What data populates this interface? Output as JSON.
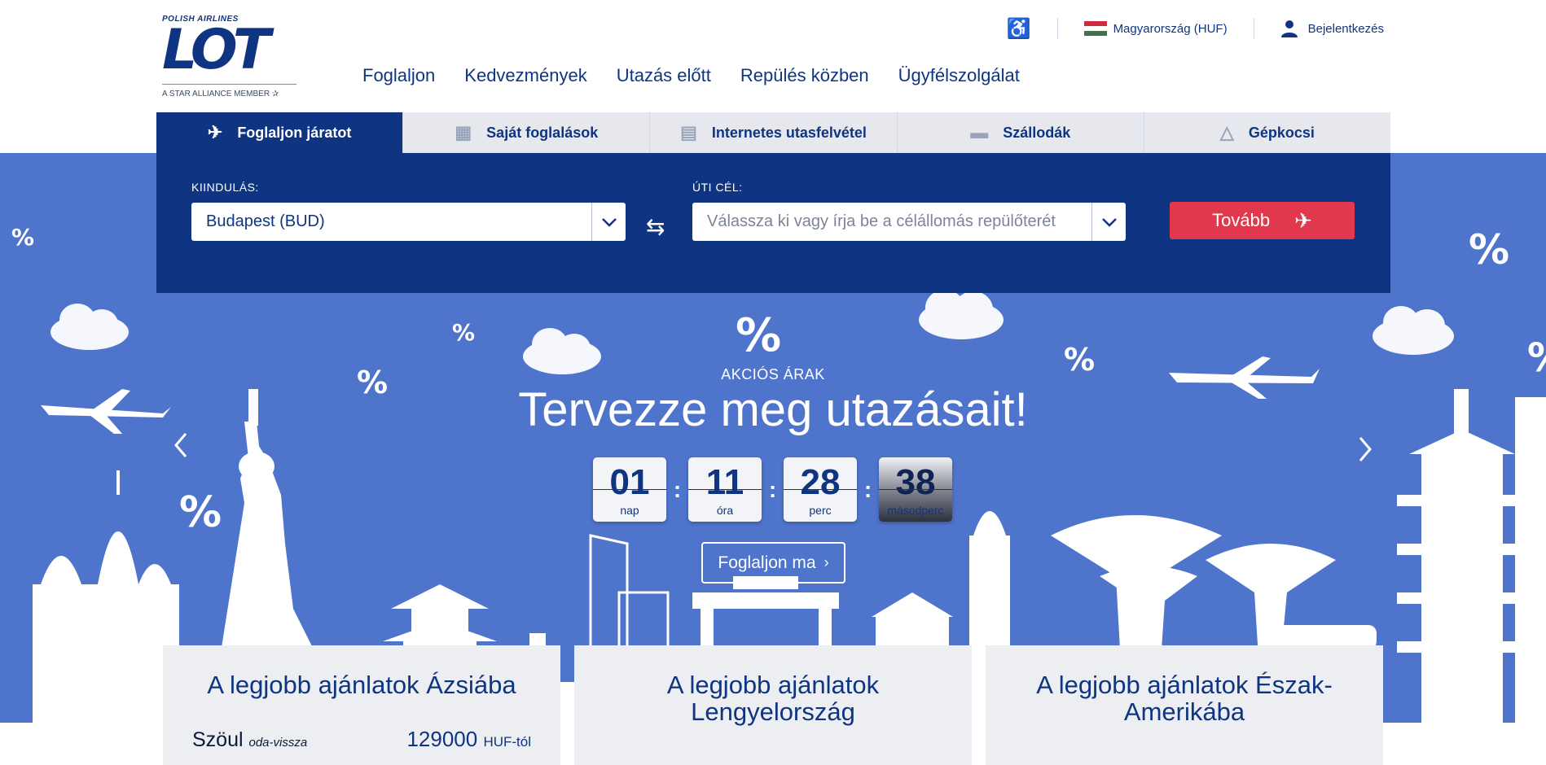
{
  "logo": {
    "supertitle": "POLISH AIRLINES",
    "mark": "LOT",
    "alliance": "A STAR ALLIANCE MEMBER"
  },
  "topbar": {
    "country": "Magyarország (HUF)",
    "login": "Bejelentkezés"
  },
  "nav": {
    "items": [
      "Foglaljon",
      "Kedvezmények",
      "Utazás előtt",
      "Repülés közben",
      "Ügyfélszolgálat"
    ]
  },
  "tabs": [
    {
      "label": "Foglaljon járatot",
      "icon": "plane-icon"
    },
    {
      "label": "Saját foglalások",
      "icon": "ticket-icon"
    },
    {
      "label": "Internetes utasfelvétel",
      "icon": "boarding-pass-icon"
    },
    {
      "label": "Szállodák",
      "icon": "bed-icon"
    },
    {
      "label": "Gépkocsi",
      "icon": "car-icon"
    }
  ],
  "search": {
    "origin_label": "KIINDULÁS:",
    "origin_value": "Budapest (BUD)",
    "destination_label": "ÚTI CÉL:",
    "destination_placeholder": "Válassza ki vagy írja be a célállomás repülőterét",
    "next_button": "Tovább"
  },
  "promo": {
    "label": "AKCIÓS ÁRAK",
    "title": "Tervezze meg utazásait!",
    "countdown": [
      {
        "value": "01",
        "unit": "nap"
      },
      {
        "value": "11",
        "unit": "óra"
      },
      {
        "value": "28",
        "unit": "perc"
      },
      {
        "value": "38",
        "unit": "másodperc"
      }
    ],
    "book_button": "Foglaljon ma",
    "percent_symbol": "%"
  },
  "cards": [
    {
      "title": "A legjobb ajánlatok Ázsiába",
      "city": "Szöul",
      "trip": "oda-vissza",
      "price": "129000",
      "price_suffix": "HUF-tól"
    },
    {
      "title": "A legjobb ajánlatok Lengyelország",
      "city": "",
      "trip": "",
      "price": "",
      "price_suffix": ""
    },
    {
      "title": "A legjobb ajánlatok Észak-Amerikába",
      "city": "",
      "trip": "",
      "price": "",
      "price_suffix": ""
    }
  ],
  "colors": {
    "navy": "#0f3582",
    "hero_blue": "#4e74cc",
    "red": "#e2384d",
    "tab_gray": "#e6e8ee"
  }
}
